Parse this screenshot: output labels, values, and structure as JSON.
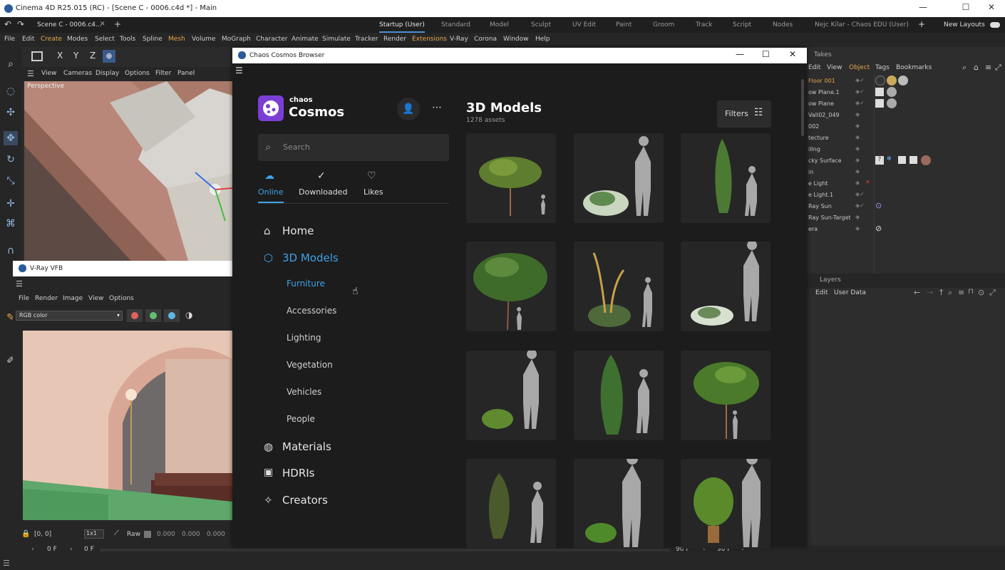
{
  "window": {
    "title": "Cinema 4D R25.015 (RC) - [Scene C - 0006.c4d *] - Main"
  },
  "doc_tab": "Scene C - 0006.c4...",
  "layout_tabs": [
    "Startup (User)",
    "Standard",
    "Model",
    "Sculpt",
    "UV Edit",
    "Paint",
    "Groom",
    "Track",
    "Script",
    "Nodes",
    "Nejc Kilar - Chaos EDU (User)"
  ],
  "new_layouts": "New Layouts",
  "menu": [
    "File",
    "Edit",
    "Create",
    "Modes",
    "Select",
    "Tools",
    "Spline",
    "Mesh",
    "Volume",
    "MoGraph",
    "Character",
    "Animate",
    "Simulate",
    "Tracker",
    "Render",
    "Extensions",
    "V-Ray",
    "Corona",
    "Window",
    "Help"
  ],
  "axes": [
    "X",
    "Y",
    "Z"
  ],
  "viewport_menu": [
    "View",
    "Cameras",
    "Display",
    "Options",
    "Filter",
    "Panel"
  ],
  "viewport_label": "Perspective",
  "vfb": {
    "title": "V-Ray VFB",
    "menu": [
      "File",
      "Render",
      "Image",
      "View",
      "Options"
    ],
    "channel": "RGB color",
    "coords": "[0, 0]",
    "zoom": "1x1",
    "raw": "Raw",
    "vals": [
      "0.000",
      "0.000",
      "0.000"
    ]
  },
  "timeline": {
    "start": "0 F",
    "start2": "0 F",
    "end": "90 F",
    "end2": "90 F"
  },
  "right_panel": {
    "takes": "Takes",
    "menu": [
      "Edit",
      "View",
      "Object",
      "Tags",
      "Bookmarks"
    ],
    "objects": [
      "Floor 001",
      "ow Plane.1",
      "ow Plane",
      "Vall02_049",
      "002",
      "tecture",
      "iling",
      "cky Surface",
      "in",
      "e Light",
      "e Light.1",
      "Ray Sun",
      "Ray Sun-Target",
      "era"
    ],
    "layers": "Layers",
    "layers_menu": [
      "Edit",
      "User Data"
    ]
  },
  "browser": {
    "title": "Chaos Cosmos Browser",
    "logo_top": "chaos",
    "logo_main": "Cosmos",
    "search_placeholder": "Search",
    "tabs": [
      "Online",
      "Downloaded",
      "Likes"
    ],
    "nav": [
      "Home",
      "3D Models",
      "Materials",
      "HDRIs",
      "Creators"
    ],
    "sub": [
      "Furniture",
      "Accessories",
      "Lighting",
      "Vegetation",
      "Vehicles",
      "People"
    ],
    "heading": "3D Models",
    "count": "1278 assets",
    "filters": "Filters"
  },
  "colors": {
    "accent": "#3ea2e6",
    "logo": "#7b3fd6"
  }
}
